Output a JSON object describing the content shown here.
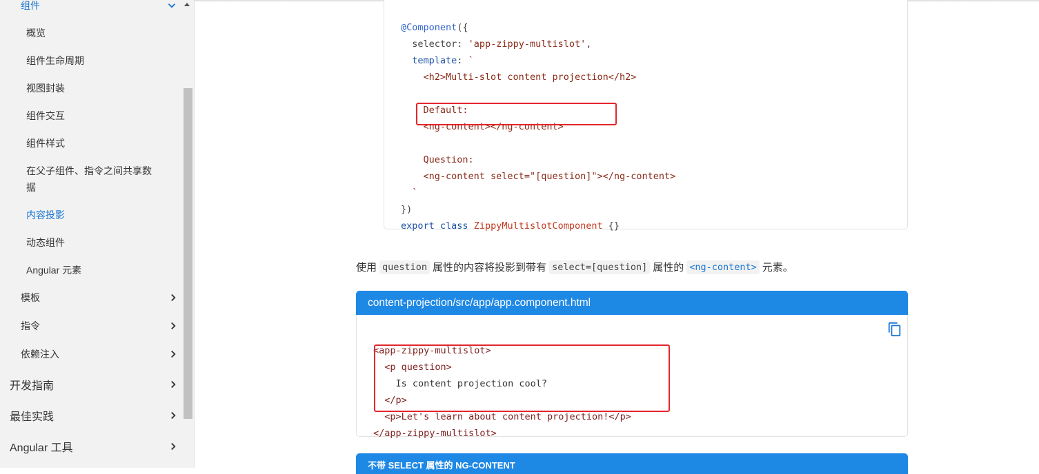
{
  "sidebar": {
    "group_title": "组件",
    "sub_items": [
      "概览",
      "组件生命周期",
      "视图封装",
      "组件交互",
      "组件样式",
      "在父子组件、指令之间共享数据",
      "内容投影",
      "动态组件",
      "Angular 元素"
    ],
    "sub_item_6_line1": "在父子组件、指令之间共享数",
    "sub_item_6_line2": "据",
    "categories": [
      "模板",
      "指令",
      "依赖注入"
    ],
    "top_items": [
      "开发指南",
      "最佳实践",
      "Angular 工具"
    ],
    "active_item": "内容投影",
    "accent_color": "#1976d2"
  },
  "code1": {
    "line1_dec": "@Component",
    "line1_rest": "({",
    "line2_key": "selector",
    "line2_str": "'app-zippy-multislot'",
    "line3_key": "template",
    "line4": "<h2>Multi-slot content projection</h2>",
    "line5": "Default:",
    "line6": "<ng-content></ng-content>",
    "line7": "Question:",
    "line8": "<ng-content select=\"[question]\"></ng-content>",
    "line9": "`",
    "line10": "})",
    "line11_kw": "export class",
    "line11_cls": "ZippyMultislotComponent",
    "line11_rest": "{}"
  },
  "paragraph": {
    "p1": "使用",
    "c1": "question",
    "p2": "属性的内容将投影到带有",
    "c2": "select=[question]",
    "p3": "属性的",
    "c3": "<ng-content>",
    "p4": "元素。"
  },
  "file": {
    "path": "content-projection/src/app/app.component.html",
    "lines": [
      "<app-zippy-multislot>",
      "  <p question>",
      "    Is content projection cool?",
      "  </p>",
      "  <p>Let's learn about content projection!</p>",
      "</app-zippy-multislot>"
    ],
    "copy_icon": "copy-icon"
  },
  "next_section_title": "不带 SELECT 属性的 NG-CONTENT",
  "colors": {
    "header_blue": "#1e88e5",
    "highlight_red": "#e3262d"
  }
}
